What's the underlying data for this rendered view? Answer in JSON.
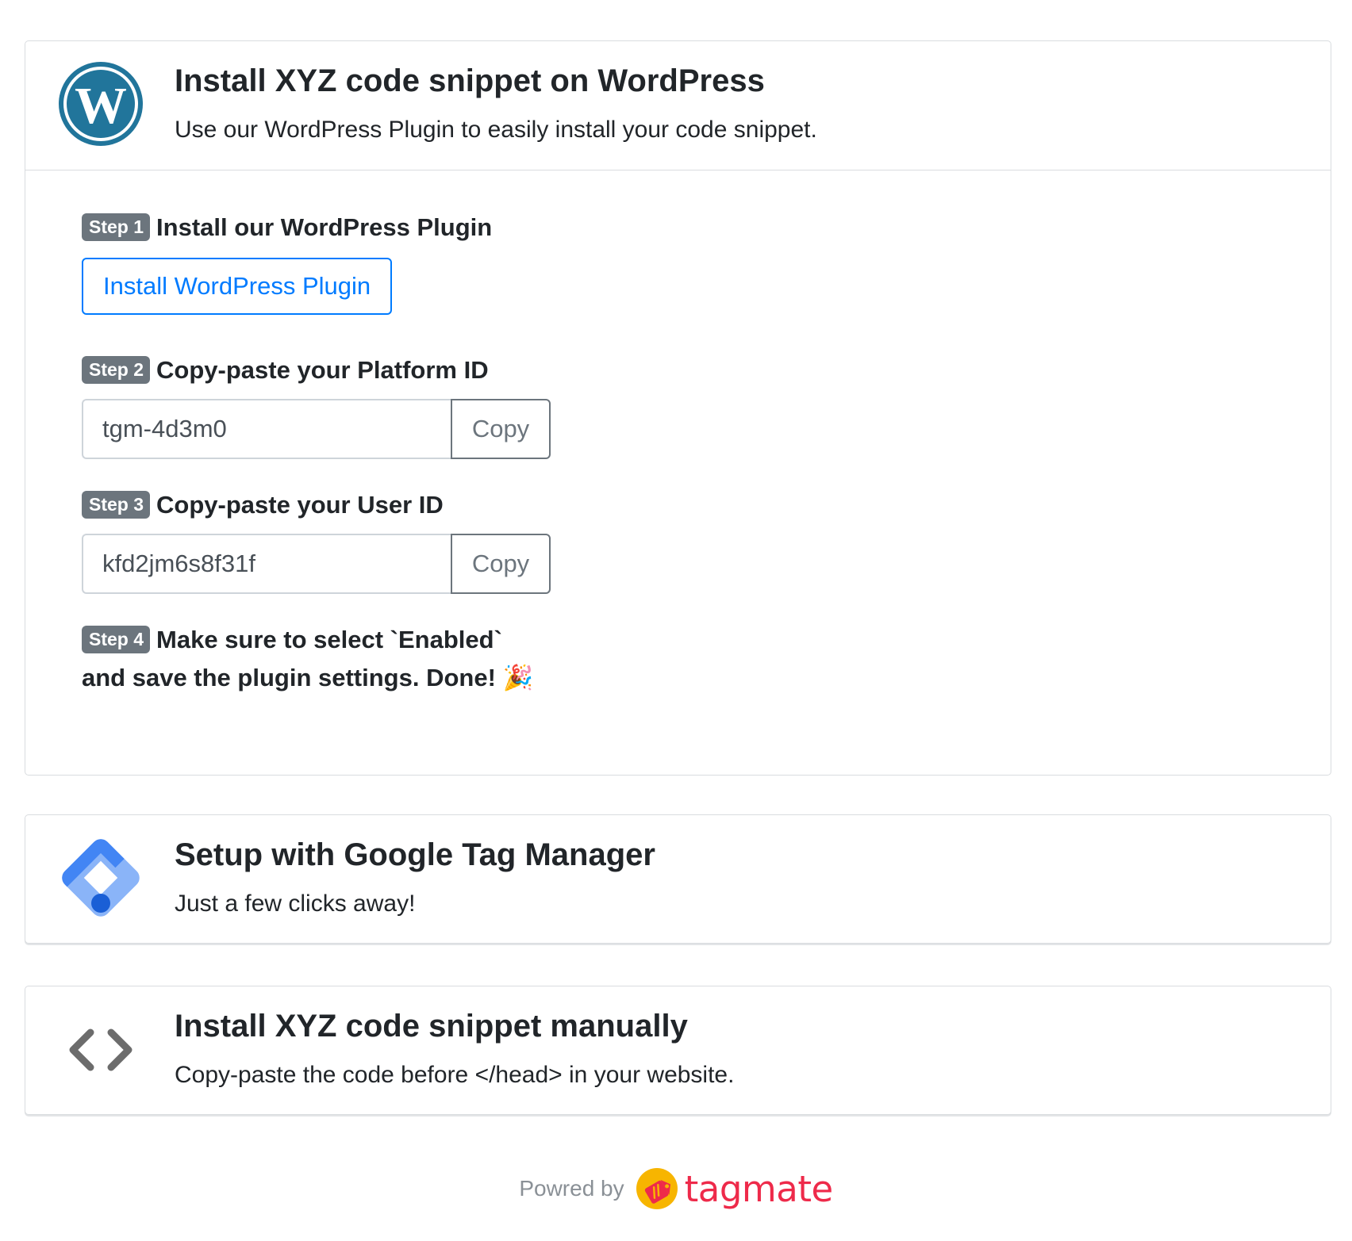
{
  "wordpress": {
    "title": "Install XYZ code snippet on WordPress",
    "subtitle": "Use our WordPress Plugin to easily install your code snippet.",
    "logo_icon": "wordpress-logo-icon",
    "steps": [
      {
        "badge": "Step 1",
        "text": "Install our WordPress Plugin",
        "button_label": "Install WordPress Plugin"
      },
      {
        "badge": "Step 2",
        "text": "Copy-paste your Platform ID",
        "value": "tgm-4d3m0",
        "copy_label": "Copy"
      },
      {
        "badge": "Step 3",
        "text": "Copy-paste your User ID",
        "value": "kfd2jm6s8f31f",
        "copy_label": "Copy"
      },
      {
        "badge": "Step 4",
        "text_line1": "Make sure to select `Enabled`",
        "text_line2": "and save the plugin settings. Done!",
        "emoji": "🎉"
      }
    ]
  },
  "gtm": {
    "title": "Setup with Google Tag Manager",
    "subtitle": "Just a few clicks away!",
    "logo_icon": "google-tag-manager-logo-icon"
  },
  "manual": {
    "title": "Install XYZ code snippet manually",
    "subtitle": "Copy-paste the code before </head> in your website.",
    "logo_icon": "code-brackets-icon"
  },
  "footer": {
    "powered_label": "Powred by",
    "brand": "tagmate"
  },
  "colors": {
    "primary": "#007bff",
    "badge": "#6c757d",
    "wordpress_blue": "#21759b",
    "gtm_blue": "#4285f4",
    "gtm_light_blue": "#8ab4f8",
    "tagmate_red": "#ee2a4a",
    "tagmate_yellow": "#f7b500"
  }
}
